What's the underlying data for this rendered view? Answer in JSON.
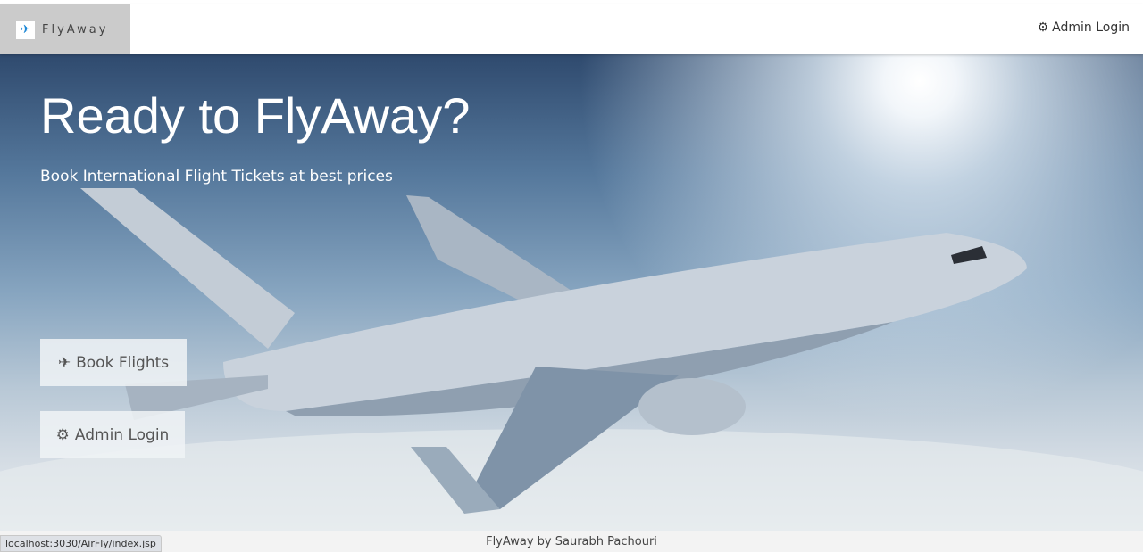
{
  "nav": {
    "brand": "FlyAway",
    "admin_login": "Admin Login"
  },
  "hero": {
    "title": "Ready to FlyAway?",
    "subtitle": "Book International Flight Tickets at best prices",
    "book_flights": "Book Flights",
    "admin_login": "Admin Login"
  },
  "footer": {
    "text": "FlyAway by Saurabh Pachouri"
  },
  "status_bar": {
    "url": "localhost:3030/AirFly/index.jsp"
  }
}
